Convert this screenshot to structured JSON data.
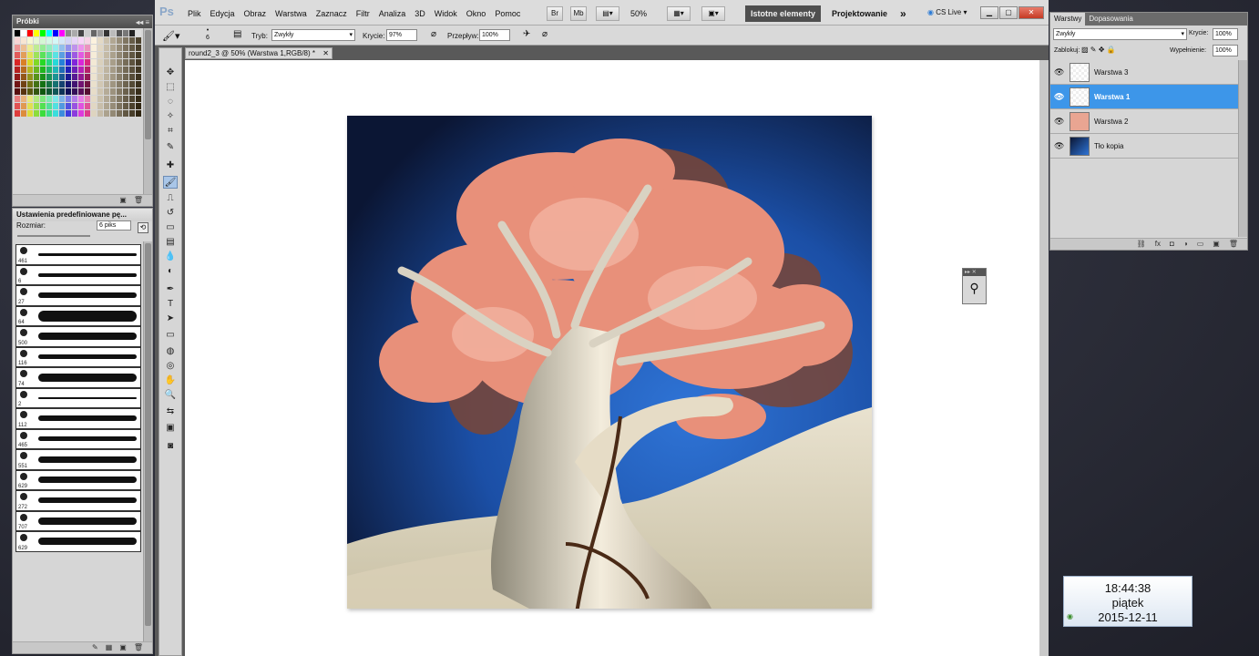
{
  "swatches": {
    "title": "Próbki"
  },
  "brush_presets": {
    "title": "Ustawienia predefiniowane pę...",
    "size_label": "Rozmiar:",
    "size_value": "6 piks",
    "items": [
      {
        "size": "461"
      },
      {
        "size": "6"
      },
      {
        "size": "27"
      },
      {
        "size": "64"
      },
      {
        "size": "500"
      },
      {
        "size": "116"
      },
      {
        "size": "74"
      },
      {
        "size": "2"
      },
      {
        "size": "112"
      },
      {
        "size": "465"
      },
      {
        "size": "551"
      },
      {
        "size": "629"
      },
      {
        "size": "272"
      },
      {
        "size": "707"
      },
      {
        "size": "629"
      }
    ]
  },
  "app": {
    "logo": "Ps",
    "menus": [
      "Plik",
      "Edycja",
      "Obraz",
      "Warstwa",
      "Zaznacz",
      "Filtr",
      "Analiza",
      "3D",
      "Widok",
      "Okno",
      "Pomoc"
    ],
    "zoom": "50%",
    "workspace_active": "Istotne elementy",
    "workspace_other": "Projektowanie",
    "more": "»",
    "cs_live": "CS Live"
  },
  "options": {
    "brush_size": "6",
    "mode_label": "Tryb:",
    "mode_value": "Zwykły",
    "opacity_label": "Krycie:",
    "opacity_value": "97%",
    "flow_label": "Przepływ:",
    "flow_value": "100%"
  },
  "document": {
    "tab_title": "round2_3 @ 50% (Warstwa 1,RGB/8) *"
  },
  "layers_panel": {
    "tabs": [
      "Warstwy",
      "Dopasowania"
    ],
    "blend_mode": "Zwykły",
    "opacity_label": "Krycie:",
    "opacity_value": "100%",
    "lock_label": "Zablokuj:",
    "fill_label": "Wypełnienie:",
    "fill_value": "100%",
    "layers": [
      {
        "name": "Warstwa 3",
        "selected": false
      },
      {
        "name": "Warstwa 1",
        "selected": true
      },
      {
        "name": "Warstwa 2",
        "selected": false
      },
      {
        "name": "Tło kopia",
        "selected": false
      }
    ]
  },
  "clock": {
    "time": "18:44:38",
    "day": "piątek",
    "date": "2015-12-11"
  },
  "colors": {
    "accent": "#3d96e9"
  }
}
